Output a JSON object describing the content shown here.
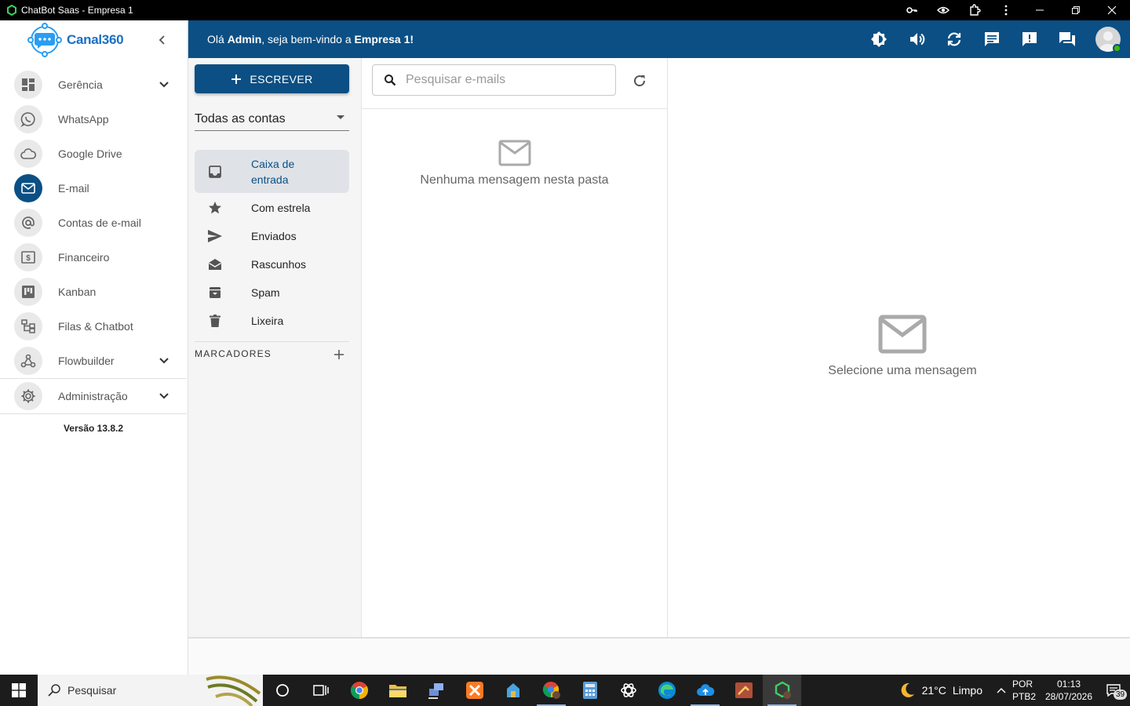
{
  "window": {
    "title": "ChatBot Saas - Empresa 1"
  },
  "sidebar": {
    "brand": "Canal360",
    "items": [
      {
        "label": "Gerência",
        "icon": "dashboard-icon",
        "expandable": true
      },
      {
        "label": "WhatsApp",
        "icon": "whatsapp-icon"
      },
      {
        "label": "Google Drive",
        "icon": "cloud-icon"
      },
      {
        "label": "E-mail",
        "icon": "mail-icon",
        "active": true
      },
      {
        "label": "Contas de e-mail",
        "icon": "at-icon"
      },
      {
        "label": "Financeiro",
        "icon": "money-icon"
      },
      {
        "label": "Kanban",
        "icon": "kanban-icon"
      },
      {
        "label": "Filas & Chatbot",
        "icon": "flow-tree-icon"
      },
      {
        "label": "Flowbuilder",
        "icon": "webhook-icon",
        "expandable": true
      },
      {
        "label": "Administração",
        "icon": "gear-icon",
        "expandable": true
      }
    ],
    "version": "Versão 13.8.2"
  },
  "header": {
    "greeting_prefix": "Olá ",
    "user": "Admin",
    "greeting_mid": ", seja bem-vindo a ",
    "company": "Empresa 1",
    "greeting_suffix": "!",
    "icons": [
      "brightness-icon",
      "volume-icon",
      "sync-icon",
      "chat-icon",
      "alert-icon",
      "forum-icon"
    ],
    "user_status_color": "#44b700"
  },
  "mail": {
    "compose_label": "ESCREVER",
    "account_filter": "Todas as contas",
    "folders": [
      {
        "label": "Caixa de entrada",
        "icon": "inbox-icon",
        "active": true
      },
      {
        "label": "Com estrela",
        "icon": "star-icon"
      },
      {
        "label": "Enviados",
        "icon": "send-icon"
      },
      {
        "label": "Rascunhos",
        "icon": "drafts-icon"
      },
      {
        "label": "Spam",
        "icon": "archive-icon"
      },
      {
        "label": "Lixeira",
        "icon": "trash-icon"
      }
    ],
    "labels_heading": "MARCADORES",
    "search_placeholder": "Pesquisar e-mails",
    "empty_folder": "Nenhuma mensagem nesta pasta",
    "empty_reading": "Selecione uma mensagem"
  },
  "taskbar": {
    "search_label": "Pesquisar",
    "weather_temp": "21°C",
    "weather_condition": "Limpo",
    "lang_primary": "POR",
    "lang_secondary": "PTB2",
    "time": "01:13",
    "date": "28/07/2026",
    "notification_count": "39"
  },
  "colors": {
    "primary": "#0b4f84",
    "accent": "#2a9df4"
  }
}
